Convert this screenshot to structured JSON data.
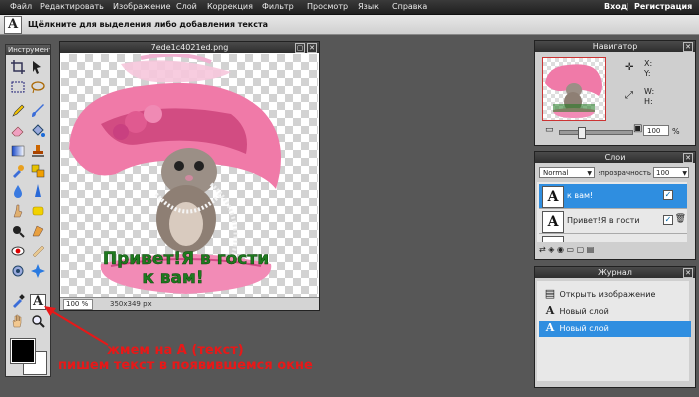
{
  "menubar": {
    "items": [
      "Файл",
      "Редактировать",
      "Изображение",
      "Слой",
      "Коррекция",
      "Фильтр",
      "Просмотр",
      "Язык",
      "Справка"
    ],
    "login": "Вход",
    "separator": "|",
    "register": "Регистрация"
  },
  "hintbar": {
    "tool_icon_glyph": "A",
    "text": "Щёлкните для выделения либо добавления текста"
  },
  "tools": {
    "title": "Инструмент",
    "icons": [
      "crop-icon",
      "move-icon",
      "marquee-icon",
      "lasso-icon",
      "pencil-icon",
      "brush-icon",
      "eraser-icon",
      "bucket-icon",
      "gradient-icon",
      "stamp-icon",
      "color-replace-icon",
      "drawing-icon",
      "blur-icon",
      "sharpen-icon",
      "smudge-icon",
      "sponge-icon",
      "dodge-icon",
      "burn-icon",
      "red-eye-icon",
      "spot-heal-icon",
      "bloat-icon",
      "pinch-icon",
      "eyedropper-icon",
      "text-icon",
      "hand-icon",
      "zoom-icon"
    ],
    "selected_tool_glyph": "A"
  },
  "image_window": {
    "title": "7ede1c4021ed.png",
    "zoom": "100 %",
    "size": "350x349 px",
    "canvas_text_line1": "Привет!Я в гости",
    "canvas_text_line2": "к вам!"
  },
  "navigator": {
    "title": "Навигатор",
    "x_label": "X:",
    "y_label": "Y:",
    "w_label": "W:",
    "h_label": "H:",
    "zoom": "100",
    "zoom_unit": "%"
  },
  "layers": {
    "title": "Слои",
    "blend_mode": "Normal",
    "opacity_label": "Непрозрачность:",
    "opacity_value": "100",
    "rows": [
      {
        "glyph": "A",
        "name": "к вам!"
      },
      {
        "glyph": "A",
        "name": "Привет!Я в гости"
      }
    ]
  },
  "history": {
    "title": "Журнал",
    "items": [
      {
        "glyph": "▤",
        "label": "Открыть изображение"
      },
      {
        "glyph": "A",
        "label": "Новый слой"
      },
      {
        "glyph": "A",
        "label": "Новый слой"
      }
    ]
  },
  "annotation": {
    "line1": "жмем на А (текст)",
    "line2": "пишем текст в появившемся окне"
  }
}
